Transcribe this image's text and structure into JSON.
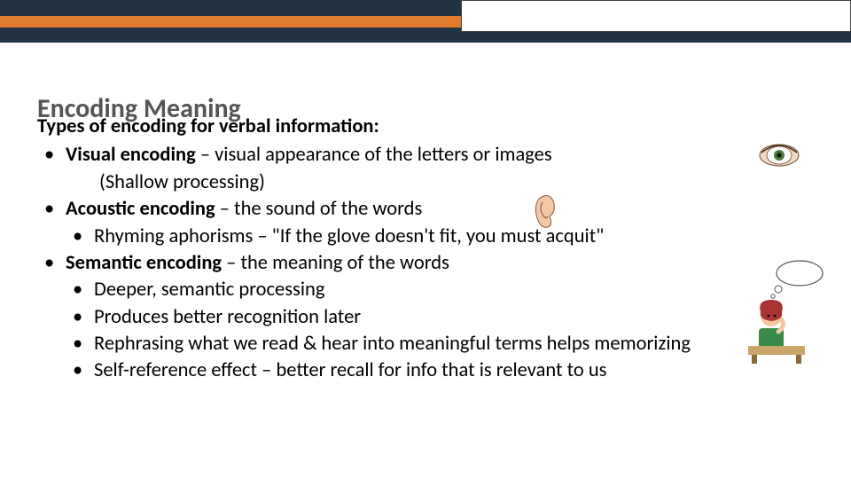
{
  "header": {
    "title": "Encoding Meaning"
  },
  "content": {
    "intro": "Types of encoding for verbal information:",
    "items": [
      {
        "bold": "Visual encoding",
        "rest": " – visual appearance of the letters or images",
        "extra": "(Shallow processing)"
      },
      {
        "bold": "Acoustic encoding",
        "rest": " – the sound of the words",
        "sub": [
          "Rhyming aphorisms – \"If the glove doesn't fit, you must acquit\""
        ]
      },
      {
        "bold": "Semantic encoding",
        "rest": " – the meaning of the words",
        "sub": [
          "Deeper, semantic processing",
          "Produces better recognition later",
          "Rephrasing what we read & hear into meaningful terms helps memorizing",
          "Self-reference effect – better recall for info that is relevant to us"
        ]
      }
    ]
  },
  "icons": {
    "eye": "eye-icon",
    "ear": "ear-icon",
    "thinker": "person-thinking-icon"
  }
}
